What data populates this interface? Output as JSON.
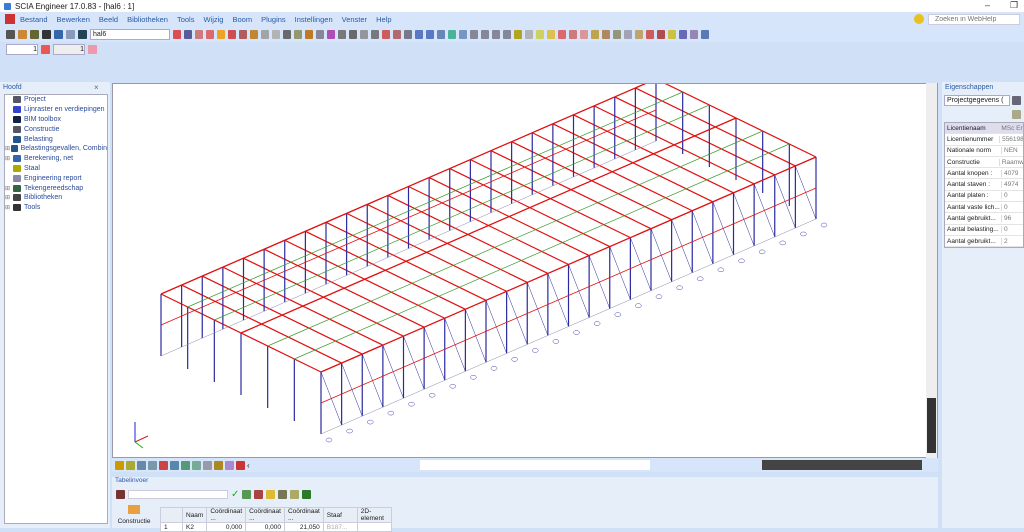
{
  "title": "SCIA Engineer 17.0.83 - [hal6 : 1]",
  "menu": [
    "Bestand",
    "Bewerken",
    "Beeld",
    "Bibliotheken",
    "Tools",
    "Wijzig",
    "Boom",
    "Plugins",
    "Instellingen",
    "Venster",
    "Help"
  ],
  "toolbar": {
    "view_select": "hal6",
    "spin1": "1",
    "spin2": "1"
  },
  "search": {
    "placeholder": "Zoeken in WebHelp"
  },
  "left_panel": {
    "title": "Hoofd",
    "items": [
      {
        "label": "Project",
        "color": "#556",
        "exp": false
      },
      {
        "label": "Lijnraster en verdiepingen",
        "color": "#34c",
        "exp": false
      },
      {
        "label": "BIM toolbox",
        "color": "#124",
        "exp": false
      },
      {
        "label": "Constructie",
        "color": "#556",
        "exp": false
      },
      {
        "label": "Belasting",
        "color": "#258",
        "exp": false
      },
      {
        "label": "Belastingsgevallen, Combin",
        "color": "#258",
        "exp": true
      },
      {
        "label": "Berekening, net",
        "color": "#36a",
        "exp": true
      },
      {
        "label": "Staal",
        "color": "#aa0",
        "exp": false
      },
      {
        "label": "Engineering report",
        "color": "#88a",
        "exp": false
      },
      {
        "label": "Tekengereedschap",
        "color": "#364",
        "exp": true
      },
      {
        "label": "Bibliotheken",
        "color": "#444",
        "exp": true
      },
      {
        "label": "Tools",
        "color": "#333",
        "exp": true
      }
    ]
  },
  "right_panel": {
    "title": "Eigenschappen",
    "select": "Projectgegevens (",
    "rows": [
      [
        "Licentienaam",
        "MSc En"
      ],
      [
        "Licentienummer",
        "556198"
      ],
      [
        "Nationale norm",
        "NEN"
      ],
      [
        "Constructie",
        "Raamw"
      ],
      [
        "Aantal knopen :",
        "4079"
      ],
      [
        "Aantal staven :",
        "4974"
      ],
      [
        "Aantal platen :",
        "0"
      ],
      [
        "Aantal vaste lich...",
        "0"
      ],
      [
        "Aantal gebruikt...",
        "96"
      ],
      [
        "Aantal belasting...",
        "0"
      ],
      [
        "Aantal gebruikt...",
        "2"
      ]
    ]
  },
  "table_panel": {
    "title": "Tabelinvoer",
    "side_button": "Constructie",
    "headers": [
      "",
      "Naam",
      "Coördinaat ...",
      "Coördinaat ...",
      "Coördinaat ...",
      "Staaf",
      "2D-element"
    ],
    "rows": [
      [
        "1",
        "K2",
        "0,000",
        "0,000",
        "21,050",
        "B187...",
        ""
      ]
    ]
  },
  "colors": {
    "columns": "#2a2aa0",
    "beams": "#e01010",
    "bracing": "#3a9a30"
  }
}
